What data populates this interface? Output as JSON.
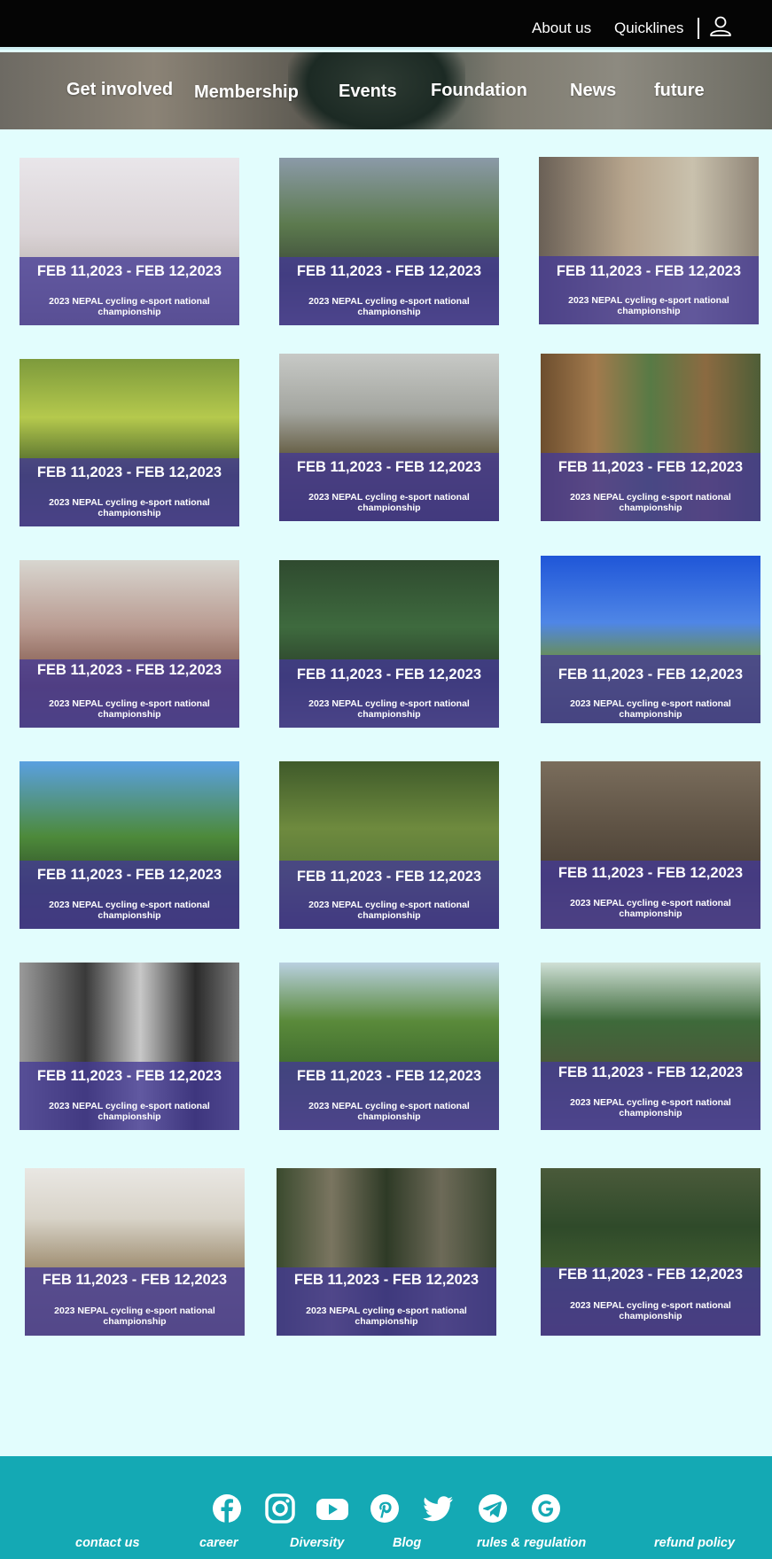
{
  "header": {
    "links": [
      {
        "label": "About us"
      },
      {
        "label": "Quicklines"
      }
    ],
    "user_icon": "user-icon"
  },
  "nav": {
    "items": [
      {
        "label": "Get involved"
      },
      {
        "label": "Membership"
      },
      {
        "label": "Events"
      },
      {
        "label": "Foundation"
      },
      {
        "label": "News"
      },
      {
        "label": "future"
      }
    ]
  },
  "events": {
    "cards": [
      {
        "date": "FEB 11,2023 - FEB 12,2023",
        "title": "2023 NEPAL cycling e-sport national championship"
      },
      {
        "date": "FEB 11,2023 - FEB 12,2023",
        "title": "2023 NEPAL cycling e-sport national championship"
      },
      {
        "date": "FEB 11,2023 - FEB 12,2023",
        "title": "2023 NEPAL cycling e-sport national championship"
      },
      {
        "date": "FEB 11,2023 - FEB 12,2023",
        "title": "2023 NEPAL cycling e-sport national championship"
      },
      {
        "date": "FEB 11,2023 - FEB 12,2023",
        "title": "2023 NEPAL cycling e-sport national championship"
      },
      {
        "date": "FEB 11,2023 - FEB 12,2023",
        "title": "2023 NEPAL cycling e-sport national championship"
      },
      {
        "date": "FEB 11,2023 - FEB 12,2023",
        "title": "2023 NEPAL cycling e-sport national championship"
      },
      {
        "date": "FEB 11,2023 - FEB 12,2023",
        "title": "2023 NEPAL cycling e-sport national championship"
      },
      {
        "date": "FEB 11,2023 - FEB 12,2023",
        "title": "2023 NEPAL cycling e-sport national championship"
      },
      {
        "date": "FEB 11,2023 - FEB 12,2023",
        "title": "2023 NEPAL cycling e-sport national championship"
      },
      {
        "date": "FEB 11,2023 - FEB 12,2023",
        "title": "2023 NEPAL cycling e-sport national championship"
      },
      {
        "date": "FEB 11,2023 - FEB 12,2023",
        "title": "2023 NEPAL cycling e-sport national championship"
      },
      {
        "date": "FEB 11,2023 - FEB 12,2023",
        "title": "2023 NEPAL cycling e-sport national championship"
      },
      {
        "date": "FEB 11,2023 - FEB 12,2023",
        "title": "2023 NEPAL cycling e-sport national championship"
      },
      {
        "date": "FEB 11,2023 - FEB 12,2023",
        "title": "2023 NEPAL cycling e-sport national championship"
      },
      {
        "date": "FEB 11,2023 - FEB 12,2023",
        "title": "2023 NEPAL cycling e-sport national championship"
      },
      {
        "date": "FEB 11,2023 - FEB 12,2023",
        "title": "2023 NEPAL cycling e-sport national championship"
      },
      {
        "date": "FEB 11,2023 - FEB 12,2023",
        "title": "2023 NEPAL cycling e-sport national championship"
      }
    ],
    "overlay_color": "#443a96"
  },
  "footer": {
    "background": "#14a9b4",
    "social_icons": [
      "facebook-icon",
      "instagram-icon",
      "youtube-icon",
      "pinterest-icon",
      "twitter-icon",
      "telegram-icon",
      "google-icon"
    ],
    "links": [
      {
        "label": "contact us"
      },
      {
        "label": "career"
      },
      {
        "label": "Diversity"
      },
      {
        "label": "Blog"
      },
      {
        "label": "rules & regulation"
      },
      {
        "label": "refund policy"
      }
    ]
  }
}
